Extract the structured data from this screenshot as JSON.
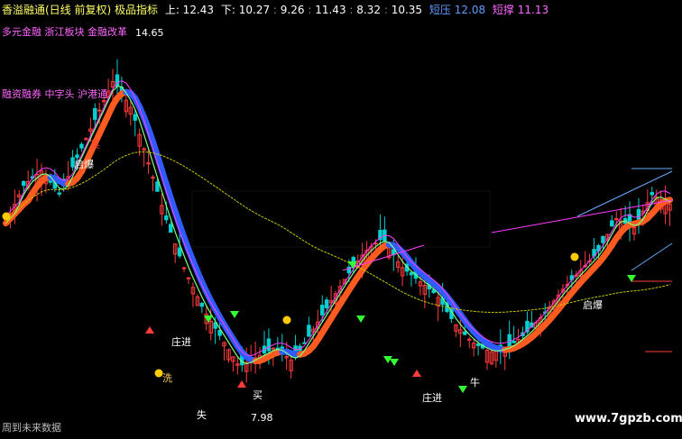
{
  "header": {
    "title": "香溢融通(日线 前复权) 极品指标",
    "hi_label": "上: 12.43",
    "lo_label": "下: 10.27",
    "v1": "9.26",
    "v2": "11.43",
    "v3": "8.32",
    "v4": "10.35",
    "short_label": "短压",
    "short_value": "12.08",
    "short2_label": "短撑",
    "short2_value": "11.13"
  },
  "concepts": {
    "line1": "多元金融 浙江板块 金融改革",
    "line2": "融资融券 中字头 沪港通"
  },
  "price_labels": {
    "peak": "14.65",
    "trough": "7.98"
  },
  "signals": {
    "qi_bao": "启爆",
    "zhu_jin": "庄进",
    "mai": "买",
    "mai2": "买",
    "niu": "牛",
    "shi": "失",
    "xi": "洗"
  },
  "bottom_left": "周到未来数据",
  "watermark": "www.7gpzb.com",
  "colors": {
    "background": "#000000",
    "up_candle": "#ff3b3b",
    "down_candle": "#00d0d0",
    "ma_orange": "#ff5a1f",
    "ma_blue": "#2f5bff",
    "line_green": "#7cff7c",
    "line_magenta": "#ff3cff",
    "line_yellow_dotted": "#c8c800",
    "header_text": "#ffff66",
    "concept_text": "#ff66ff"
  },
  "chart_data": {
    "type": "candlestick",
    "period": "daily",
    "adjusted": "forward",
    "price_high_marked": 14.65,
    "price_low_marked": 7.98,
    "approx_close_path": [
      11.2,
      12.0,
      12.3,
      11.8,
      12.6,
      13.4,
      14.2,
      13.6,
      12.4,
      11.2,
      10.2,
      9.4,
      8.8,
      8.2,
      8.4,
      8.6,
      8.3,
      8.9,
      9.5,
      10.1,
      10.6,
      10.9,
      10.3,
      10.0,
      9.7,
      9.1,
      8.7,
      8.5,
      8.6,
      8.9,
      9.3,
      9.8,
      10.2,
      10.6,
      11.3,
      11.1,
      11.8,
      11.6
    ]
  }
}
